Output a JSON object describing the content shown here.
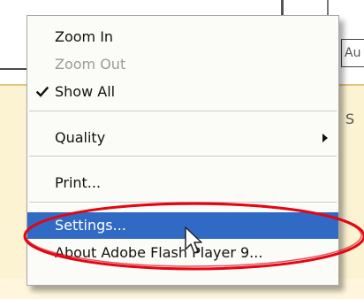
{
  "background": {
    "right_text_top": "Au",
    "right_text_mid": "S"
  },
  "context_menu": {
    "items": [
      {
        "label": "Zoom In",
        "enabled": true,
        "checked": false
      },
      {
        "label": "Zoom Out",
        "enabled": false,
        "checked": false
      },
      {
        "label": "Show All",
        "enabled": true,
        "checked": true
      },
      {
        "label": "Quality",
        "enabled": true,
        "has_submenu": true
      },
      {
        "label": "Print...",
        "enabled": true
      },
      {
        "label": "Settings...",
        "enabled": true,
        "selected": true
      },
      {
        "label": "About Adobe Flash Player 9...",
        "enabled": true
      }
    ]
  },
  "colors": {
    "highlight": "#316ac5",
    "annotation": "#e30613",
    "disabled_text": "#9b9b9b"
  },
  "icons": {
    "check": "check-mark-icon",
    "submenu": "submenu-arrow-icon",
    "pointer": "mouse-cursor-icon"
  }
}
